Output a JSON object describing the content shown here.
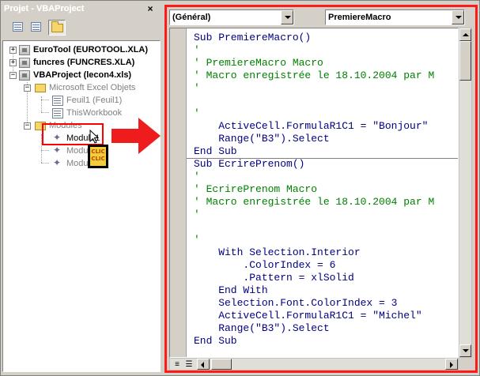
{
  "project_explorer": {
    "title": "Projet - VBAProject",
    "close_glyph": "×",
    "tree": {
      "eurotool": "EuroTool (EUROTOOL.XLA)",
      "funcres": "funcres (FUNCRES.XLA)",
      "vbaproject": "VBAProject (lecon4.xls)",
      "excel_objects": "Microsoft Excel Objets",
      "feuil1": "Feuil1 (Feuil1)",
      "thisworkbook": "ThisWorkbook",
      "modules": "Modules",
      "module1": "Module1",
      "module2": "Modu",
      "module3": "Modul"
    },
    "expand_plus": "+",
    "expand_minus": "−",
    "clic_label": "CLIC CLIC"
  },
  "code_window": {
    "object_combo": "(Général)",
    "procedure_combo": "PremiereMacro",
    "lines": [
      "Sub PremiereMacro()",
      "'",
      "' PremiereMacro Macro",
      "' Macro enregistrée le 18.10.2004 par M",
      "'",
      "",
      "'",
      "    ActiveCell.FormulaR1C1 = \"Bonjour\"",
      "    Range(\"B3\").Select",
      "End Sub",
      "Sub EcrirePrenom()",
      "'",
      "' EcrirePrenom Macro",
      "' Macro enregistrée le 18.10.2004 par M",
      "'",
      "",
      "'",
      "    With Selection.Interior",
      "        .ColorIndex = 6",
      "        .Pattern = xlSolid",
      "    End With",
      "    Selection.Font.ColorIndex = 3",
      "    ActiveCell.FormulaR1C1 = \"Michel\"",
      "    Range(\"B3\").Select",
      "End Sub"
    ],
    "line_kinds": [
      "kw",
      "cm",
      "cm",
      "cm",
      "cm",
      "kw",
      "cm",
      "kw",
      "kw",
      "kw",
      "kw",
      "cm",
      "cm",
      "cm",
      "cm",
      "kw",
      "cm",
      "kw",
      "kw",
      "kw",
      "kw",
      "kw",
      "kw",
      "kw",
      "kw"
    ],
    "view_buttons": [
      "≡",
      "☰"
    ]
  },
  "colors": {
    "highlight_red": "#ff0000",
    "keyword_blue": "#000080",
    "comment_green": "#008000",
    "dialog_gray": "#d4d0c8"
  }
}
